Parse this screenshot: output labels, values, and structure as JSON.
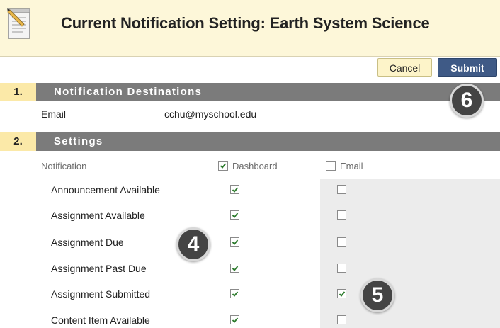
{
  "header": {
    "title": "Current Notification Setting: Earth System Science",
    "icon": "notepad-icon"
  },
  "toolbar": {
    "cancel_label": "Cancel",
    "submit_label": "Submit"
  },
  "steps": [
    {
      "number": "1.",
      "label": "Notification Destinations"
    },
    {
      "number": "2.",
      "label": "Settings"
    }
  ],
  "destinations": {
    "email_label": "Email",
    "email_value": "cchu@myschool.edu"
  },
  "settings": {
    "columns": {
      "notification": "Notification",
      "dashboard": "Dashboard",
      "email": "Email"
    },
    "header_checks": {
      "dashboard": true,
      "email": false
    },
    "rows": [
      {
        "label": "Announcement Available",
        "dashboard": true,
        "email": false
      },
      {
        "label": "Assignment Available",
        "dashboard": true,
        "email": false
      },
      {
        "label": "Assignment Due",
        "dashboard": true,
        "email": false
      },
      {
        "label": "Assignment Past Due",
        "dashboard": true,
        "email": false
      },
      {
        "label": "Assignment Submitted",
        "dashboard": true,
        "email": true
      },
      {
        "label": "Content Item Available",
        "dashboard": true,
        "email": false
      }
    ]
  },
  "callouts": [
    "6",
    "4",
    "5"
  ],
  "colors": {
    "header_bg": "#fdf7d9",
    "step_bar": "#7b7b7b",
    "step_number_bg": "#fbe9a8",
    "submit_bg": "#3f5a86",
    "check_color": "#2b7a2b"
  }
}
